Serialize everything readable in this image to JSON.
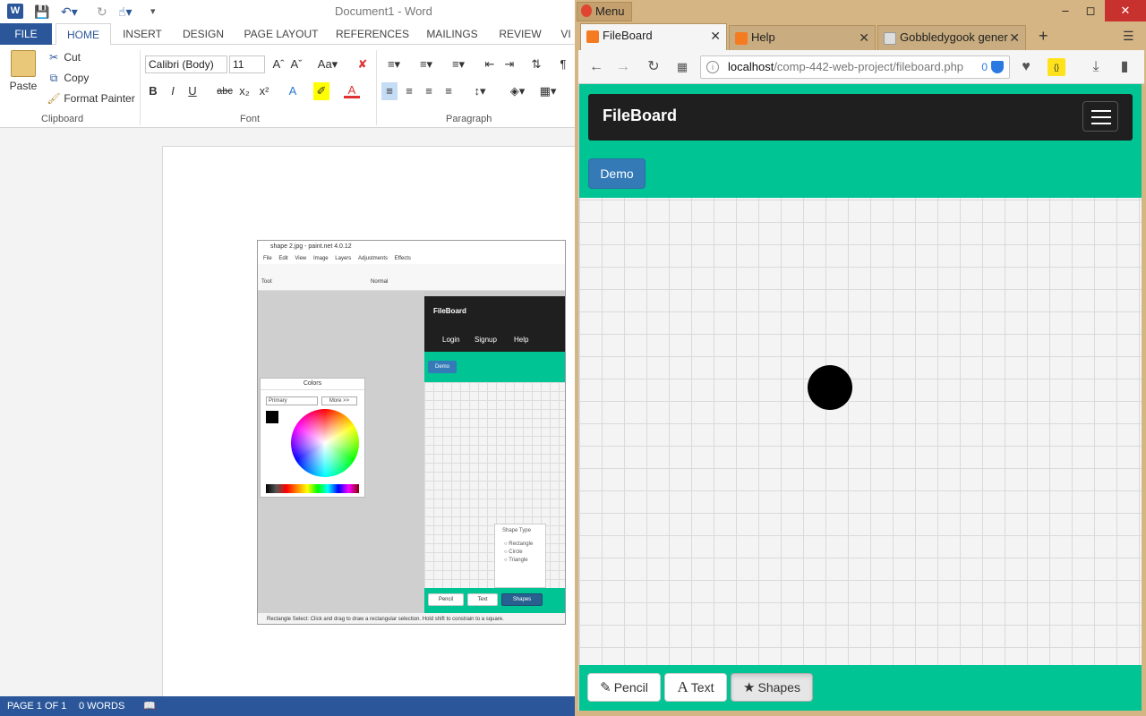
{
  "word": {
    "title": "Document1 - Word",
    "file_tab": "FILE",
    "tabs": [
      "HOME",
      "INSERT",
      "DESIGN",
      "PAGE LAYOUT",
      "REFERENCES",
      "MAILINGS",
      "REVIEW",
      "VI"
    ],
    "clipboard": {
      "paste": "Paste",
      "cut": "Cut",
      "copy": "Copy",
      "format_painter": "Format Painter",
      "group": "Clipboard"
    },
    "font": {
      "name": "Calibri (Body)",
      "size": "11",
      "group": "Font"
    },
    "paragraph": {
      "group": "Paragraph"
    },
    "status": {
      "page": "PAGE 1 OF 1",
      "words": "0 WORDS"
    },
    "embedded": {
      "title": "shape 2.jpg - paint.net 4.0.12",
      "menu": [
        "File",
        "Edit",
        "View",
        "Image",
        "Layers",
        "Adjustments",
        "Effects"
      ],
      "tool_label": "Tool:",
      "blend": "Normal",
      "colors_title": "Colors",
      "primary": "Primary",
      "more": "More >>",
      "fb_brand": "FileBoard",
      "fb_nav": [
        "Login",
        "Signup",
        "Help"
      ],
      "fb_demo": "Demo",
      "shape_type": "Shape Type",
      "shape_options": [
        "Rectangle",
        "Circle",
        "Triangle"
      ],
      "fb_buttons": [
        "Pencil",
        "Text",
        "Shapes"
      ],
      "status": "Rectangle Select: Click and drag to draw a rectangular selection. Hold shift to constrain to a square."
    }
  },
  "firefox": {
    "menu": "Menu",
    "tabs": [
      {
        "label": "FileBoard",
        "active": true
      },
      {
        "label": "Help",
        "active": false
      },
      {
        "label": "Gobbledygook gener",
        "active": false
      }
    ],
    "url_host": "localhost",
    "url_path": "/comp-442-web-project/fileboard.php",
    "url_badge": "0",
    "page": {
      "brand": "FileBoard",
      "demo": "Demo",
      "buttons": [
        {
          "label": "Pencil",
          "icon": "pencil-icon",
          "active": false
        },
        {
          "label": "Text",
          "icon": "text-icon",
          "active": false
        },
        {
          "label": "Shapes",
          "icon": "star-icon",
          "active": true
        }
      ]
    }
  },
  "colors": {
    "word_blue": "#2b579a",
    "fileboard_green": "#00c494",
    "navbar_dark": "#1f1f1f",
    "demo_blue": "#337ab7",
    "firefox_frame": "#d6b584"
  }
}
